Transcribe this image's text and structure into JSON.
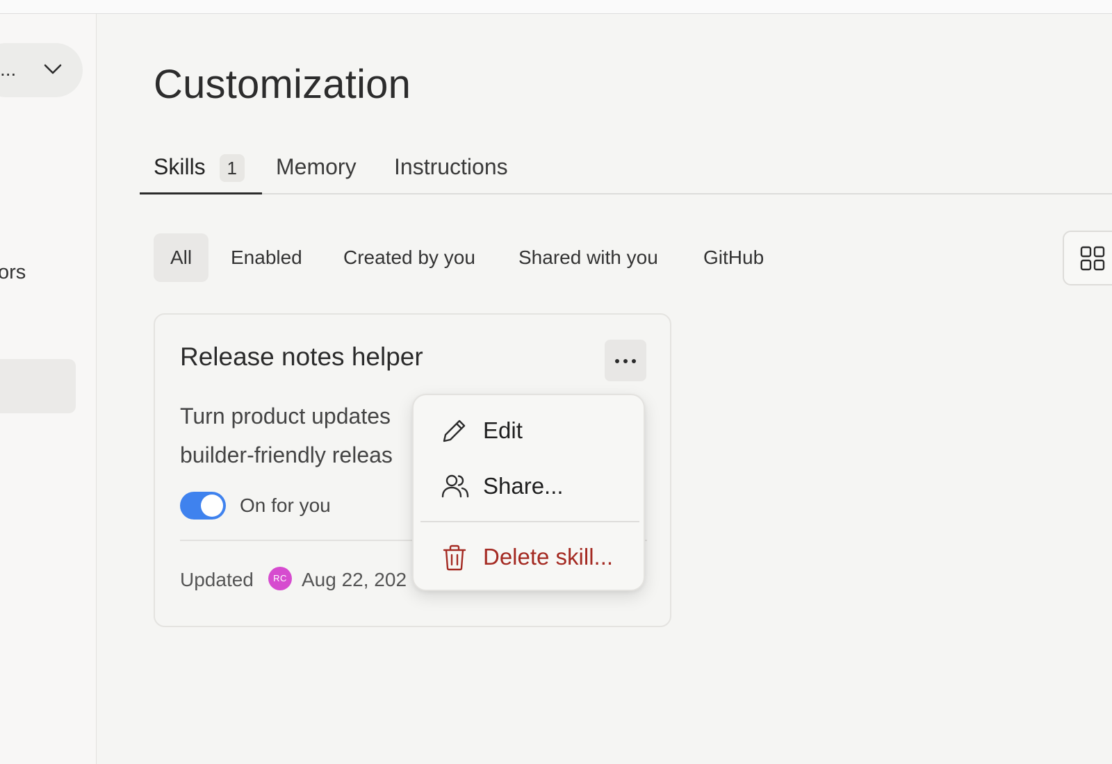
{
  "sidebar": {
    "select_label": "...",
    "item_partial": "ors"
  },
  "page": {
    "title": "Customization"
  },
  "tabs": [
    {
      "label": "Skills",
      "badge": "1"
    },
    {
      "label": "Memory"
    },
    {
      "label": "Instructions"
    }
  ],
  "filters": [
    "All",
    "Enabled",
    "Created by you",
    "Shared with you",
    "GitHub"
  ],
  "card": {
    "title": "Release notes helper",
    "description_line1": "Turn product updates",
    "description_line2": "builder-friendly releas",
    "toggle_label": "On for you",
    "toggle_on": true,
    "updated_label": "Updated",
    "avatar_initials": "RC",
    "updated_date": "Aug 22, 202"
  },
  "menu": {
    "edit": "Edit",
    "share": "Share...",
    "delete": "Delete skill..."
  },
  "colors": {
    "accent": "#3f82ee",
    "danger": "#a42a22",
    "avatar": "#d64bcf"
  }
}
